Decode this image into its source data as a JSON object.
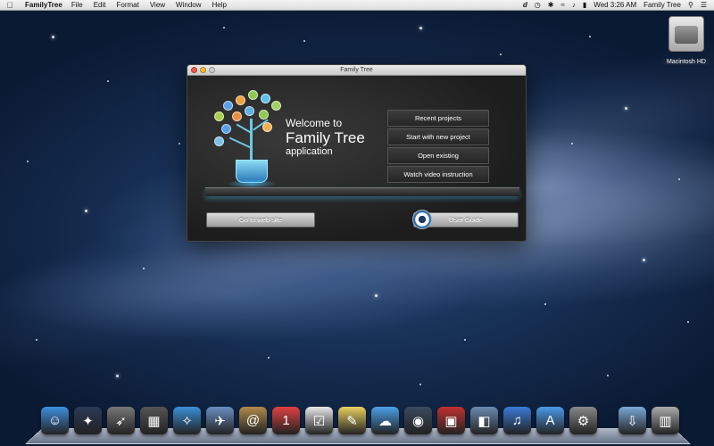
{
  "menubar": {
    "app_name": "FamilyTree",
    "menus": [
      "File",
      "Edit",
      "Format",
      "View",
      "Window",
      "Help"
    ],
    "clock": "Wed 3:26 AM",
    "user_name": "Family Tree"
  },
  "desktop": {
    "drive_label": "Macintosh HD"
  },
  "window": {
    "title": "Family Tree",
    "welcome": {
      "line1": "Welcome to",
      "line2": "Family Tree",
      "line3": "application"
    },
    "menu_buttons": [
      "Recent projects",
      "Start with new project",
      "Open existing",
      "Watch video instruction"
    ],
    "web_button": "Go to web site",
    "guide_button": "User Guide"
  },
  "dock": {
    "icons": [
      {
        "name": "finder-icon",
        "glyph": "☺",
        "color": "#3d8fe0"
      },
      {
        "name": "launchpad-icon",
        "glyph": "✦",
        "color": "#2a3a55"
      },
      {
        "name": "rocket-icon",
        "glyph": "➶",
        "color": "#777"
      },
      {
        "name": "mission-control-icon",
        "glyph": "▦",
        "color": "#555"
      },
      {
        "name": "safari-icon",
        "glyph": "✧",
        "color": "#3a8fd8"
      },
      {
        "name": "mail-icon",
        "glyph": "✈",
        "color": "#6a8fc0"
      },
      {
        "name": "contacts-icon",
        "glyph": "@",
        "color": "#b08a4a"
      },
      {
        "name": "calendar-icon",
        "glyph": "1",
        "color": "#e04040"
      },
      {
        "name": "reminders-icon",
        "glyph": "☑",
        "color": "#e8e8e8"
      },
      {
        "name": "notes-icon",
        "glyph": "✎",
        "color": "#e8d060"
      },
      {
        "name": "messages-icon",
        "glyph": "☁",
        "color": "#4aa0e8"
      },
      {
        "name": "facetime-icon",
        "glyph": "◉",
        "color": "#3a4a60"
      },
      {
        "name": "photo-booth-icon",
        "glyph": "▣",
        "color": "#c03030"
      },
      {
        "name": "iphoto-icon",
        "glyph": "◧",
        "color": "#6a8ab0"
      },
      {
        "name": "itunes-icon",
        "glyph": "♫",
        "color": "#3a7ad8"
      },
      {
        "name": "app-store-icon",
        "glyph": "A",
        "color": "#4a9ae8"
      },
      {
        "name": "system-preferences-icon",
        "glyph": "⚙",
        "color": "#888"
      },
      {
        "name": "downloads-folder-icon",
        "glyph": "⇩",
        "color": "#7aa8d8"
      },
      {
        "name": "trash-icon",
        "glyph": "▥",
        "color": "#aaa"
      }
    ]
  }
}
